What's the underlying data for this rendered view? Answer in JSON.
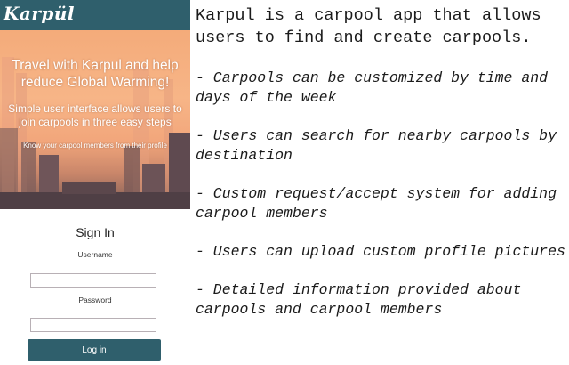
{
  "app": {
    "logo": "Karpül",
    "brand_color": "#2f5f6c"
  },
  "hero": {
    "title": "Travel with Karpul and help reduce Global Warming!",
    "subtitle": "Simple user interface allows users to join carpools in three easy steps",
    "note": "Know your carpool members from their profile"
  },
  "signin": {
    "title": "Sign In",
    "username_label": "Username",
    "username_value": "",
    "password_label": "Password",
    "password_value": "",
    "login_label": "Log in"
  },
  "description": {
    "intro": "Karpul is a carpool app that allows users to find and create carpools.",
    "features": [
      "- Carpools can be customized by time and days of the week",
      "- Users can search for nearby carpools by destination",
      "- Custom request/accept system for adding carpool members",
      "- Users can upload custom profile pictures",
      "- Detailed information provided about carpools and carpool members"
    ]
  }
}
